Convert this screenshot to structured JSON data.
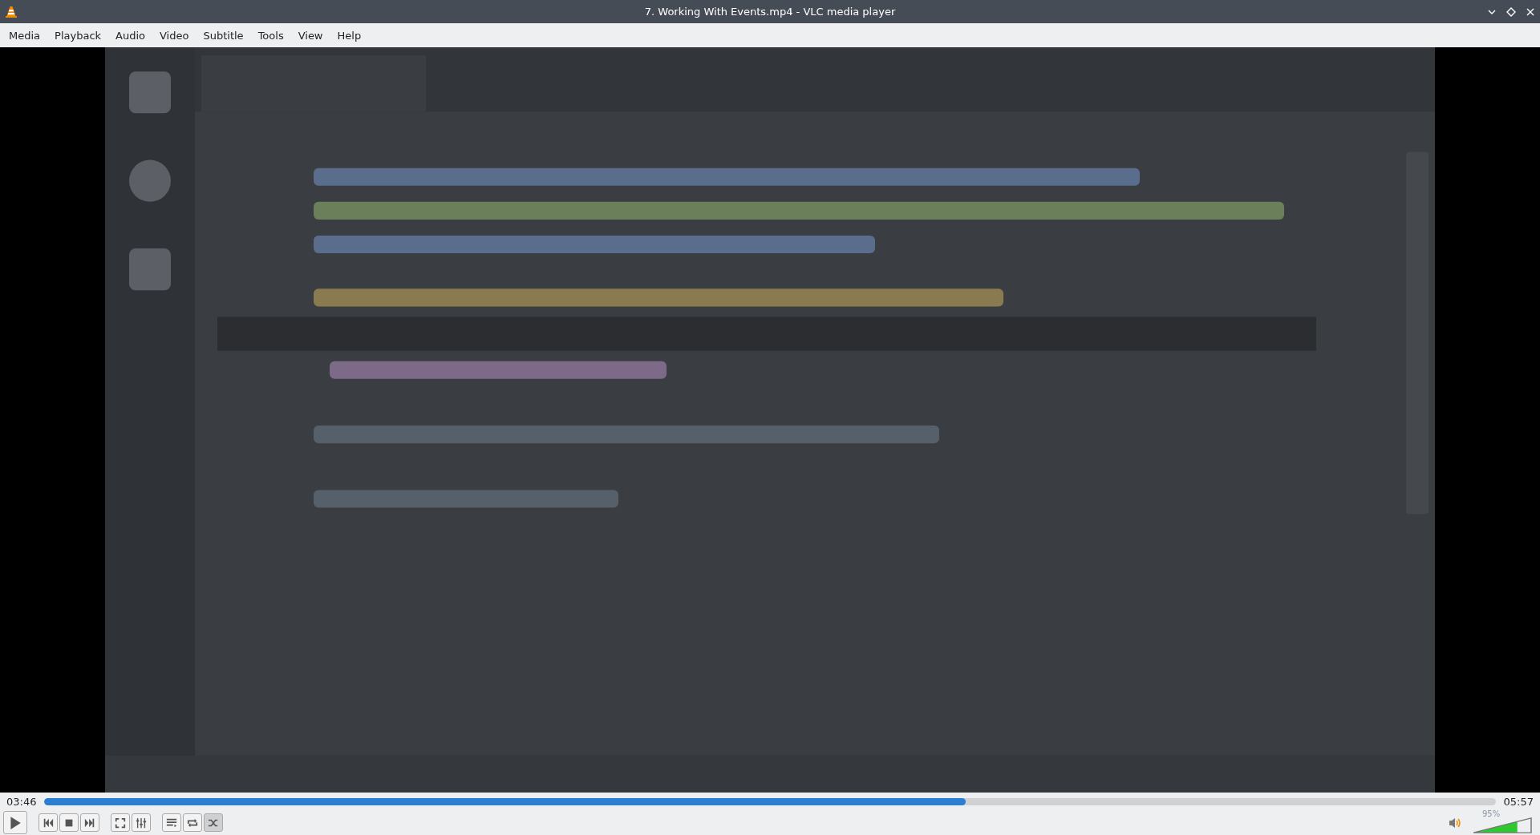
{
  "window": {
    "title": "7. Working With Events.mp4 - VLC media player"
  },
  "menu": [
    "Media",
    "Playback",
    "Audio",
    "Video",
    "Subtitle",
    "Tools",
    "View",
    "Help"
  ],
  "video": {
    "kind": "picture"
  },
  "seek": {
    "elapsed": "03:46",
    "total": "05:57",
    "level": 0.635
  },
  "controls": [
    {
      "kind": "play",
      "pressed": false
    },
    {
      "kind": "previous",
      "pressed": false
    },
    {
      "kind": "stop",
      "pressed": false
    },
    {
      "kind": "next",
      "pressed": false
    },
    {
      "kind": "fullscreen",
      "pressed": false
    },
    {
      "kind": "extended",
      "pressed": false
    },
    {
      "kind": "playlist",
      "pressed": false
    },
    {
      "kind": "loop",
      "pressed": false
    },
    {
      "kind": "random",
      "pressed": true
    }
  ],
  "volume": {
    "reading": "95%",
    "level": 0.76,
    "muted": false
  }
}
